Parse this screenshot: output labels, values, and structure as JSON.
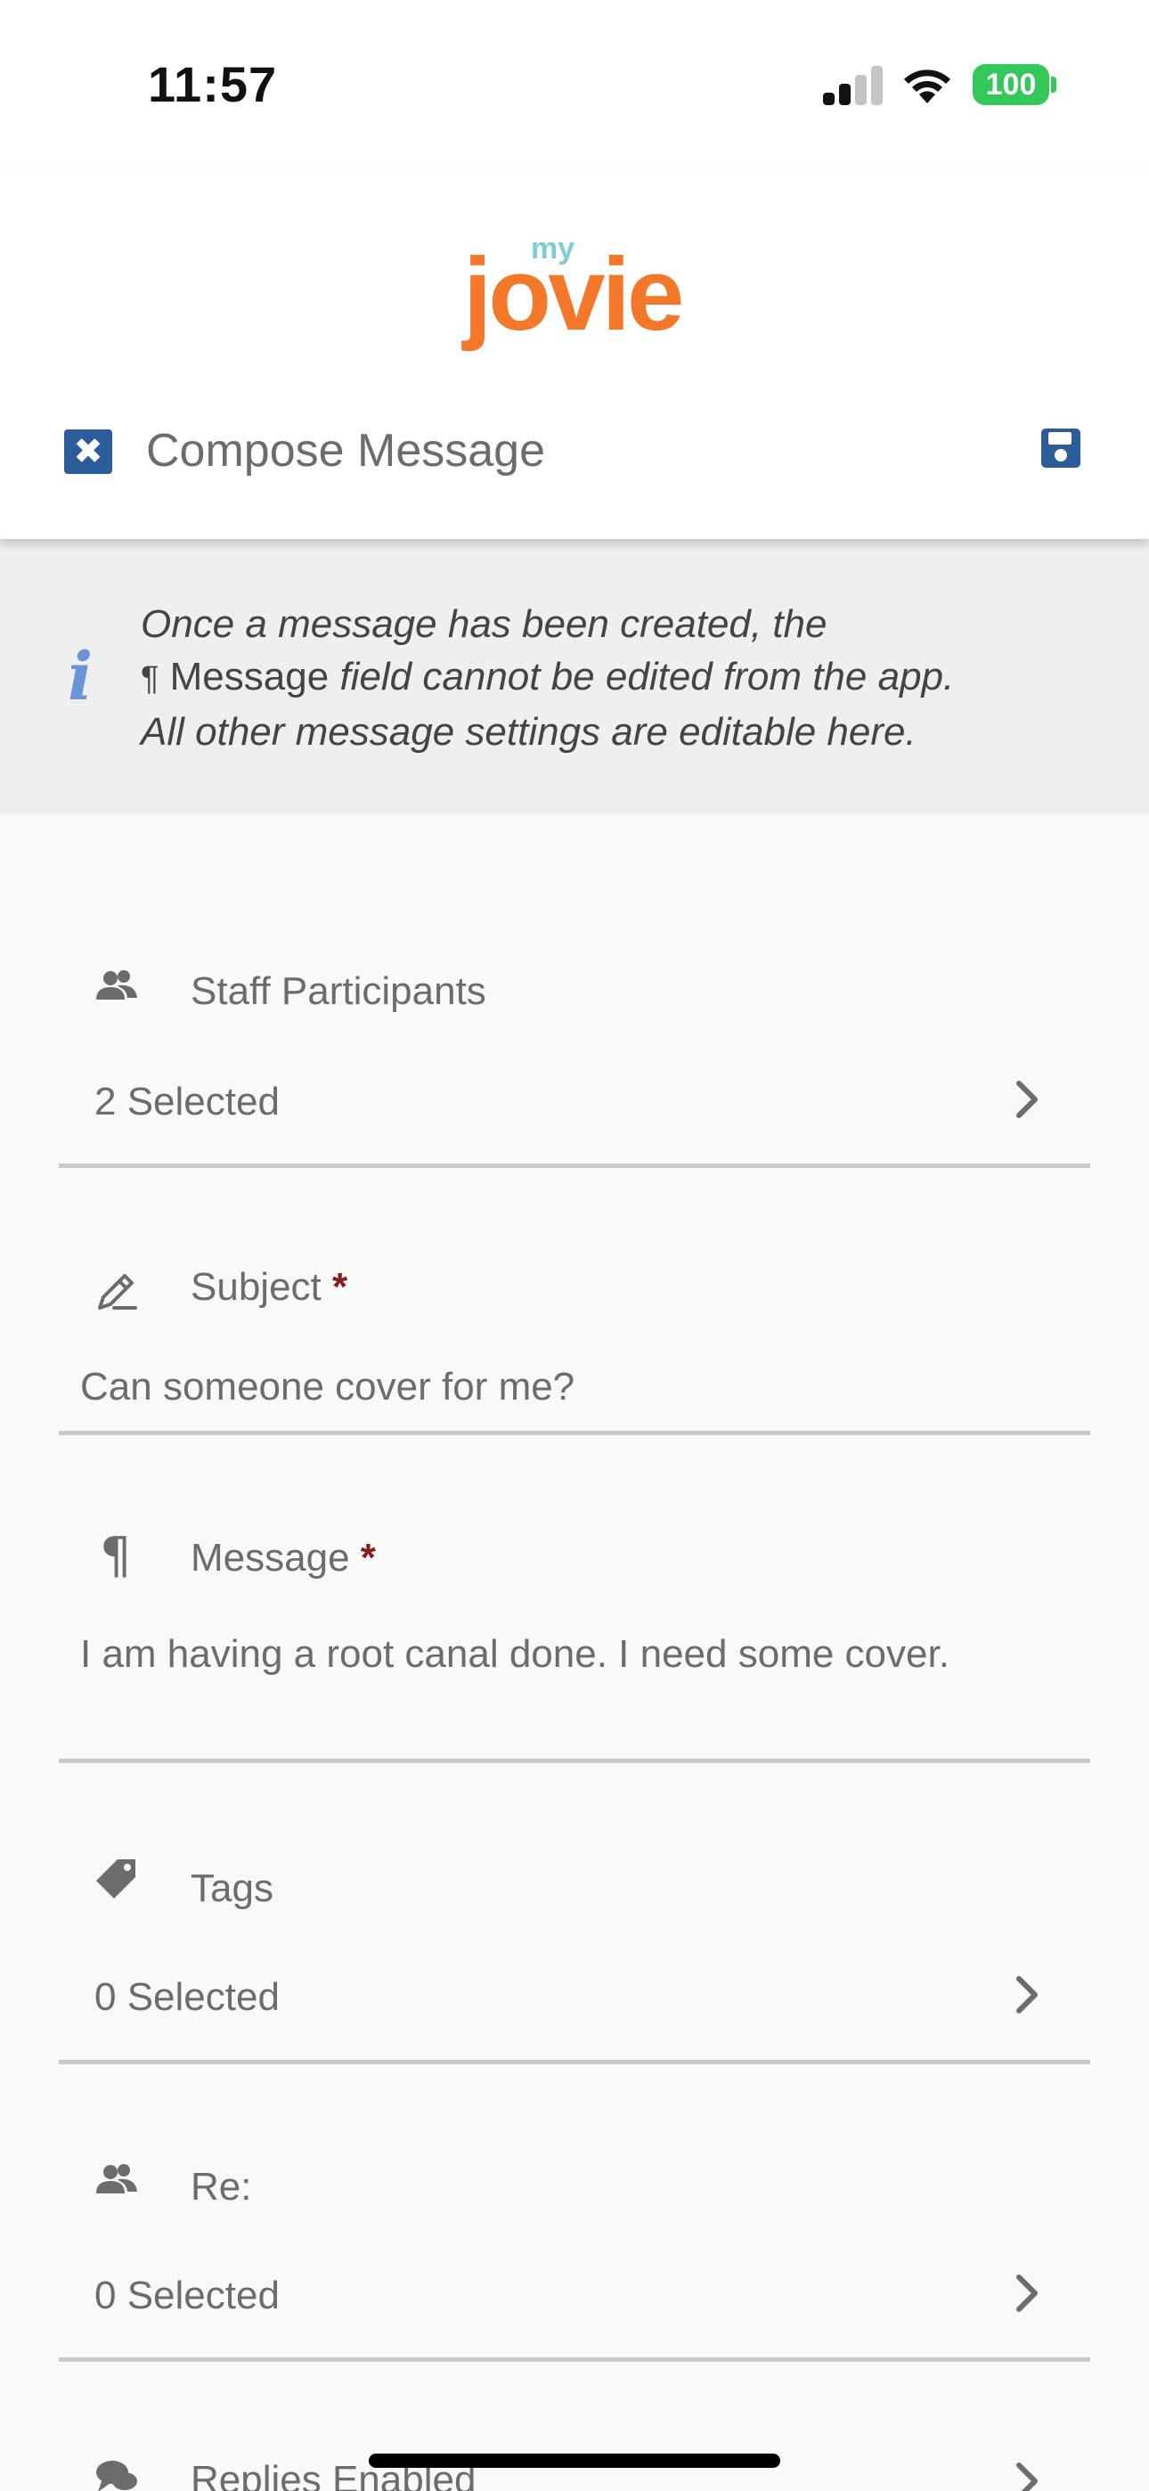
{
  "status_bar": {
    "time": "11:57",
    "battery": "100"
  },
  "header": {
    "logo_my": "my",
    "logo_jovie": "jovie",
    "title": "Compose Message",
    "close_glyph": "✖"
  },
  "info_banner": {
    "line1": "Once a message has been created, the",
    "pilcrow": "¶",
    "field_name": "Message",
    "line2_rest": "field cannot be edited from the app.",
    "line3": "All other message settings are editable here."
  },
  "fields": {
    "staff": {
      "label": "Staff Participants",
      "value": "2 Selected"
    },
    "subject": {
      "label": "Subject",
      "required": "*",
      "value": "Can someone cover for me?"
    },
    "message": {
      "label": "Message",
      "required": "*",
      "value": "I am having a root canal done. I need some cover."
    },
    "tags": {
      "label": "Tags",
      "value": "0 Selected"
    },
    "re": {
      "label": "Re:",
      "value": "0 Selected"
    },
    "replies": {
      "label": "Replies Enabled"
    }
  },
  "icons": {
    "close": "close-icon",
    "save": "floppy-disk-icon",
    "info": "info-icon",
    "users": "users-icon",
    "pencil": "pencil-icon",
    "pilcrow": "pilcrow-icon",
    "tag": "tag-icon",
    "chat": "chat-bubbles-icon",
    "chevron": "chevron-right-icon"
  },
  "colors": {
    "accent_blue": "#2b5d9a",
    "logo_orange": "#f4782a",
    "logo_teal": "#7dcdd8",
    "required_red": "#8b1a1a",
    "battery_green": "#34c759",
    "info_blue": "#6b93d6"
  }
}
